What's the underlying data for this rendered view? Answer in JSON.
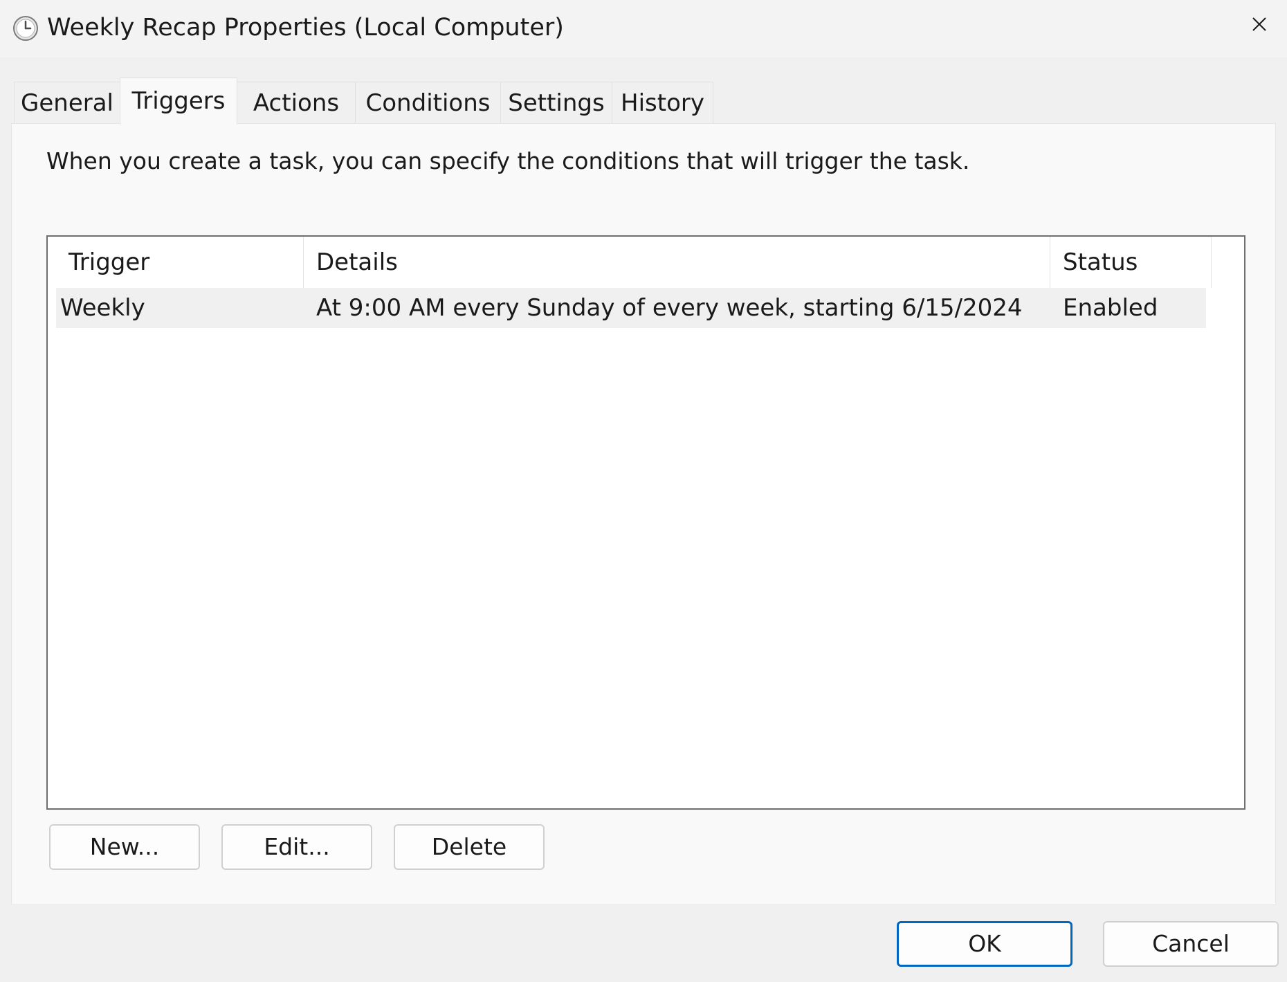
{
  "window": {
    "title": "Weekly Recap Properties (Local Computer)",
    "icon": "clock-icon",
    "close_icon": "close-icon"
  },
  "tabs": [
    {
      "label": "General",
      "active": false
    },
    {
      "label": "Triggers",
      "active": true
    },
    {
      "label": "Actions",
      "active": false
    },
    {
      "label": "Conditions",
      "active": false
    },
    {
      "label": "Settings",
      "active": false
    },
    {
      "label": "History",
      "active": false
    }
  ],
  "triggers_panel": {
    "intro": "When you create a task, you can specify the conditions that will trigger the task.",
    "columns": [
      "Trigger",
      "Details",
      "Status"
    ],
    "rows": [
      {
        "trigger": "Weekly",
        "details": "At 9:00 AM every Sunday of every week, starting 6/15/2024",
        "status": "Enabled",
        "selected": true
      }
    ],
    "buttons": {
      "new": "New...",
      "edit": "Edit...",
      "delete": "Delete"
    }
  },
  "footer": {
    "ok": "OK",
    "cancel": "Cancel"
  },
  "colors": {
    "accent": "#0067c0",
    "selected_row": "#f0f0f0",
    "list_border": "#6e6e6e"
  }
}
